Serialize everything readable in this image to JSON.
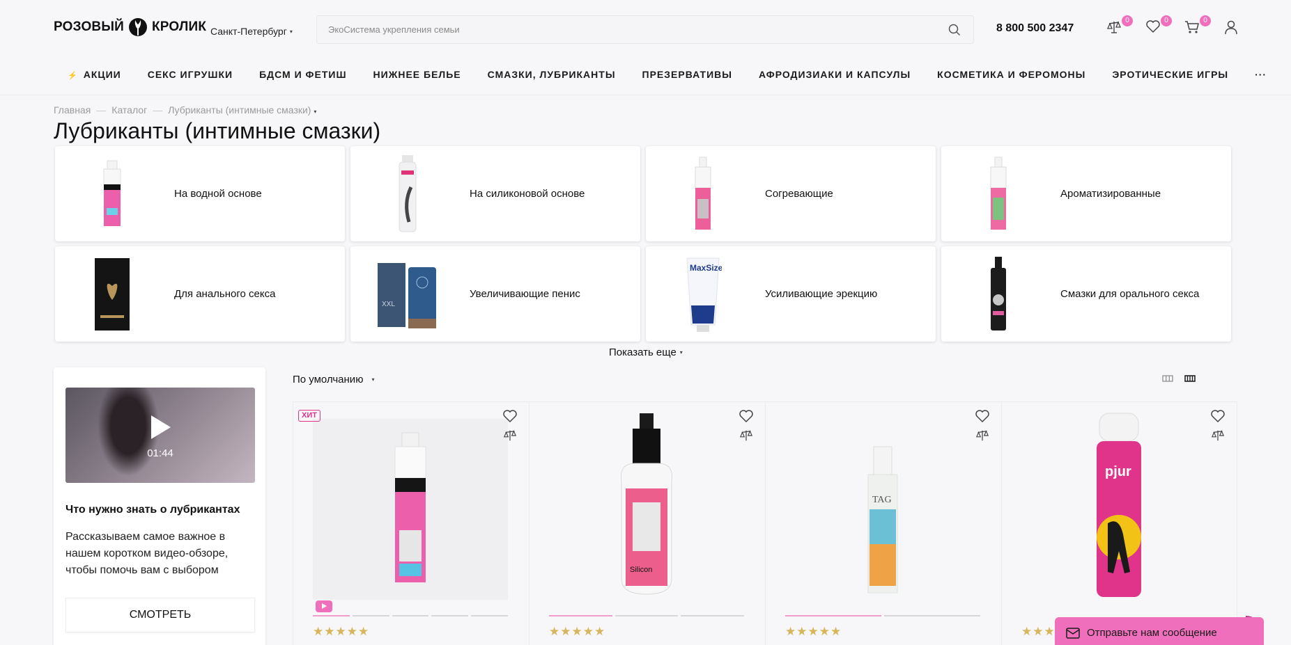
{
  "header": {
    "logo_text_left": "РОЗОВЫЙ",
    "logo_text_right": "КРОЛИК",
    "city": "Санкт-Петербург",
    "search_placeholder": "ЭкоСистема укрепления семьи",
    "phone": "8 800 500 2347",
    "compare_count": "0",
    "favorites_count": "0",
    "cart_count": "0"
  },
  "nav": {
    "items": [
      {
        "label": "АКЦИИ"
      },
      {
        "label": "СЕКС ИГРУШКИ"
      },
      {
        "label": "БДСМ И ФЕТИШ"
      },
      {
        "label": "НИЖНЕЕ БЕЛЬЕ"
      },
      {
        "label": "СМАЗКИ, ЛУБРИКАНТЫ"
      },
      {
        "label": "ПРЕЗЕРВАТИВЫ"
      },
      {
        "label": "АФРОДИЗИАКИ И КАПСУЛЫ"
      },
      {
        "label": "КОСМЕТИКА И ФЕРОМОНЫ"
      },
      {
        "label": "ЭРОТИЧЕСКИЕ ИГРЫ"
      }
    ],
    "more_label": "···"
  },
  "breadcrumbs": [
    "Главная",
    "Каталог",
    "Лубриканты (интимные смазки)"
  ],
  "page_title": "Лубриканты (интимные смазки)",
  "categories": [
    {
      "label": "На водной основе",
      "icon": "bottle-pink-icon"
    },
    {
      "label": "На силиконовой основе",
      "icon": "bottle-white-icon"
    },
    {
      "label": "Согревающие",
      "icon": "spray-bottle-icon"
    },
    {
      "label": "Ароматизированные",
      "icon": "spray-bottle-icon"
    },
    {
      "label": "Для анального секса",
      "icon": "black-box-icon"
    },
    {
      "label": "Увеличивающие пенис",
      "icon": "cream-tube-icon"
    },
    {
      "label": "Усиливающие эрекцию",
      "icon": "tube-icon"
    },
    {
      "label": "Смазки для орального секса",
      "icon": "black-spray-icon"
    }
  ],
  "show_more": "Показать еще",
  "video": {
    "duration": "01:44",
    "title": "Что нужно знать о лубрикантах",
    "description": "Рассказываем самое важное в нашем коротком видео-обзоре, чтобы помочь вам с выбором",
    "button": "СМОТРЕТЬ"
  },
  "sort": {
    "label": "По умолчанию"
  },
  "products": [
    {
      "badge": "ХИТ",
      "has_video": true,
      "rating_stars": "★★★★★",
      "image": "pink-pump-bottle",
      "bar_count": 5,
      "bar_active": 1
    },
    {
      "badge": "",
      "has_video": false,
      "rating_stars": "★★★★★",
      "image": "silicon-lubricant-bottle",
      "bar_count": 3,
      "bar_active": 1
    },
    {
      "badge": "",
      "has_video": false,
      "rating_stars": "★★★★★",
      "image": "tag-pump-bottle",
      "bar_count": 2,
      "bar_active": 1
    },
    {
      "badge": "",
      "has_video": false,
      "rating_stars": "★★★★★",
      "image": "pjur-myglide-bottle",
      "bar_count": 0,
      "bar_active": 0
    }
  ],
  "chat": {
    "label": "Отправьте нам сообщение"
  },
  "colors": {
    "accent": "#f06fbd",
    "accent_dark": "#b73c85",
    "stars": "#d8b55b"
  }
}
